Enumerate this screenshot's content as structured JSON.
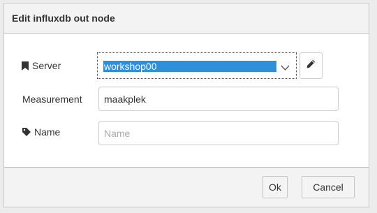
{
  "dialog": {
    "title": "Edit influxdb out node"
  },
  "form": {
    "server": {
      "label": "Server",
      "icon": "bookmark-icon",
      "selected": "workshop00",
      "edit_icon": "pencil-icon"
    },
    "measurement": {
      "label": "Measurement",
      "value": "maakplek"
    },
    "name": {
      "label": "Name",
      "icon": "tag-icon",
      "placeholder": "Name",
      "value": ""
    }
  },
  "footer": {
    "ok_label": "Ok",
    "cancel_label": "Cancel"
  },
  "colors": {
    "selection": "#2e8fdb",
    "header_bg": "#f3f3f3"
  }
}
